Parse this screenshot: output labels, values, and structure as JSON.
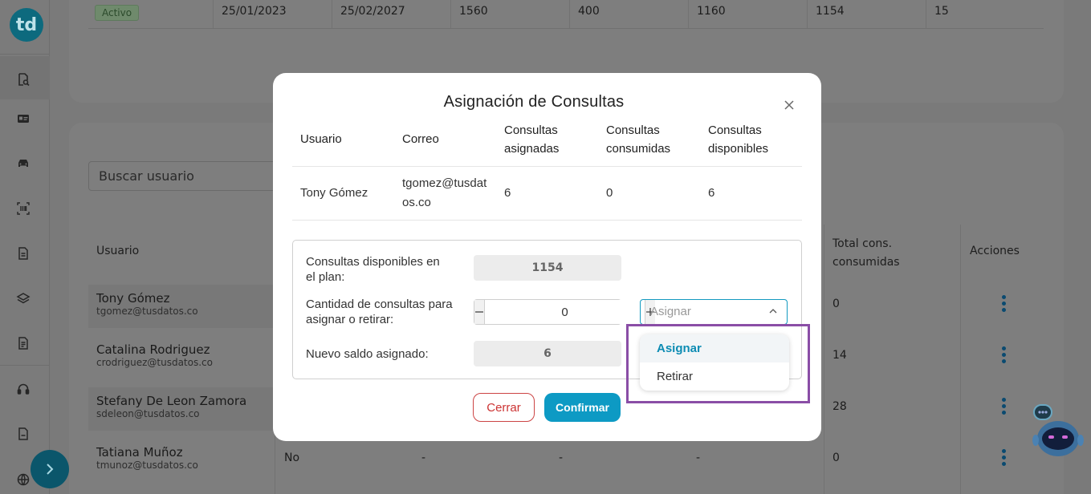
{
  "sidebar": {
    "logo": "td",
    "icons": [
      "search-document-icon",
      "id-card-icon",
      "car-icon",
      "barcode-scan-icon",
      "document-icon",
      "layers-icon",
      "file-text-icon",
      "headset-icon",
      "file-icon",
      "globe-icon"
    ]
  },
  "background": {
    "top_row": {
      "status": "Activo",
      "start_date": "25/01/2023",
      "end_date": "25/02/2027",
      "col3": "1560",
      "col4": "400",
      "col5": "1160",
      "col6": "1154",
      "col7": "15"
    },
    "search_placeholder": "Buscar usuario",
    "headers": {
      "user": "Usuario",
      "total_consumed": "Total cons. consumidas",
      "actions": "Acciones"
    },
    "users": [
      {
        "name": "Tony Gómez",
        "email": "tgomez@tusdatos.co",
        "total": "0"
      },
      {
        "name": "Catalina Rodriguez",
        "email": "crodriguez@tusdatos.co",
        "total": "14"
      },
      {
        "name": "Stefany De Leon Zamora",
        "email": "sdeleon@tusdatos.co",
        "total": "28"
      },
      {
        "name": "Tatiana Muñoz",
        "email": "tmunoz@tusdatos.co",
        "total": "0",
        "flag": "No",
        "c1": "-",
        "c2": "-",
        "c3": "-"
      }
    ]
  },
  "modal": {
    "title": "Asignación de Consultas",
    "table": {
      "headers": {
        "user": "Usuario",
        "email": "Correo",
        "assigned": "Consultas asignadas",
        "consumed": "Consultas consumidas",
        "available": "Consultas disponibles"
      },
      "row": {
        "user": "Tony Gómez",
        "email": "tgomez@tusdatos.co",
        "assigned": "6",
        "consumed": "0",
        "available": "6"
      }
    },
    "form": {
      "plan_label": "Consultas disponibles en el plan:",
      "plan_value": "1154",
      "qty_label": "Cantidad de consultas para asignar o retirar:",
      "qty_value": "0",
      "action_placeholder": "Asignar",
      "new_balance_label": "Nuevo saldo asignado:",
      "new_balance_value": "6"
    },
    "buttons": {
      "cancel": "Cerrar",
      "confirm": "Confirmar"
    }
  },
  "dropdown": {
    "options": [
      "Asignar",
      "Retirar"
    ],
    "active_index": 0
  },
  "colors": {
    "accent": "#0d9ac4",
    "cancel": "#cc3333",
    "highlight": "#8a4ea6"
  }
}
